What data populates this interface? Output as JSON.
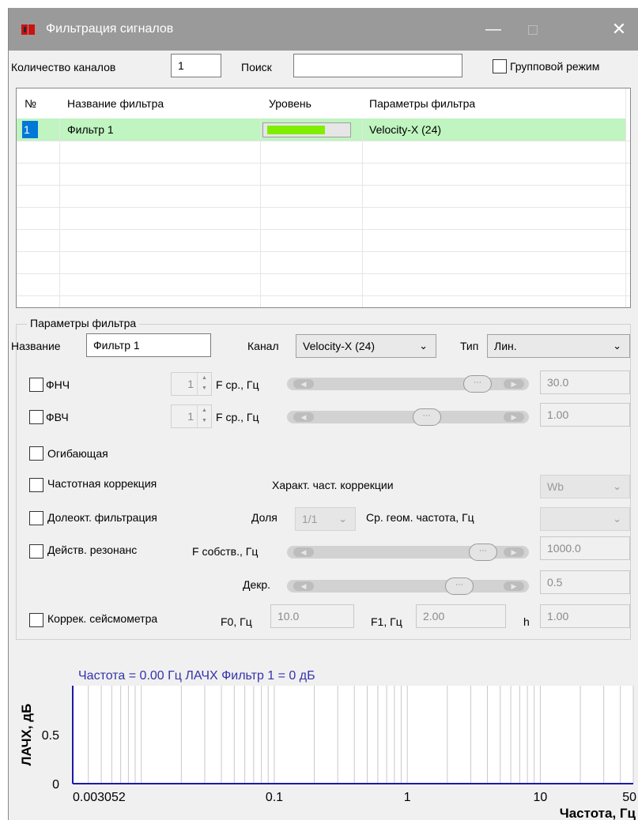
{
  "window": {
    "title": "Фильтрация сигналов",
    "minimize_icon": "minimize-icon",
    "maximize_icon": "maximize-icon",
    "close_icon": "close-icon"
  },
  "toolbar": {
    "channel_count_label": "Количество каналов",
    "channel_count_value": "1",
    "search_label": "Поиск",
    "search_value": "",
    "group_mode_label": "Групповой режим",
    "group_mode_checked": false
  },
  "table": {
    "columns": [
      "№",
      "Название фильтра",
      "Уровень",
      "Параметры фильтра"
    ],
    "rows": [
      {
        "num": "1",
        "name": "Фильтр 1",
        "level": 0.85,
        "level_color": "#80ee00",
        "params": "Velocity-X (24)"
      }
    ],
    "row_highlight_color": "#c0f4c0"
  },
  "filter_params": {
    "group_title": "Параметры фильтра",
    "name_label": "Название",
    "name_value": "Фильтр 1",
    "channel_label": "Канал",
    "channel_value": "Velocity-X (24)",
    "type_label": "Тип",
    "type_value": "Лин.",
    "lpf_label": "ФНЧ",
    "lpf_order": "1",
    "lpf_freq_label": "F ср., Гц",
    "lpf_freq_value": "30.0",
    "lpf_slider_pos": 0.9,
    "hpf_label": "ФВЧ",
    "hpf_order": "1",
    "hpf_freq_label": "F ср., Гц",
    "hpf_freq_value": "1.00",
    "hpf_slider_pos": 0.62,
    "envelope_label": "Огибающая",
    "freq_corr_label": "Частотная коррекция",
    "freq_corr_char_label": "Характ. част. коррекции",
    "freq_corr_char_value": "Wb",
    "fract_oct_label": "Долеокт. фильтрация",
    "fraction_label": "Доля",
    "fraction_value": "1/1",
    "geo_freq_label": "Ср. геом. частота, Гц",
    "geo_freq_value": "",
    "resonance_label": "Действ. резонанс",
    "own_freq_label": "F собств., Гц",
    "own_freq_value": "1000.0",
    "own_freq_slider_pos": 0.93,
    "decr_label": "Декр.",
    "decr_value": "0.5",
    "decr_slider_pos": 0.8,
    "seismo_label": "Коррек. сейсмометра",
    "f0_label": "F0, Гц",
    "f0_value": "10.0",
    "f1_label": "F1, Гц",
    "f1_value": "2.00",
    "h_label": "h",
    "h_value": "1.00"
  },
  "chart_data": {
    "type": "line",
    "title": "Частота = 0.00 Гц    ЛАЧХ Фильтр 1 = 0 дБ",
    "xlabel": "Частота, Гц",
    "ylabel": "ЛАЧХ, дБ",
    "x_scale": "log",
    "xlim": [
      0.003052,
      50
    ],
    "ylim": [
      0,
      1
    ],
    "x_tick_labels": [
      "0.003052",
      "0.1",
      "1",
      "10",
      "50"
    ],
    "x_tick_values": [
      0.003052,
      0.1,
      1,
      10,
      50
    ],
    "y_tick_labels": [
      "0",
      "0.5"
    ],
    "y_tick_values": [
      0,
      0.5
    ],
    "grid": true,
    "series": [
      {
        "color": "#1a1aaa",
        "x": [
          0.003052,
          50
        ],
        "y": [
          0,
          0
        ]
      }
    ],
    "title_color": "#3333aa"
  }
}
